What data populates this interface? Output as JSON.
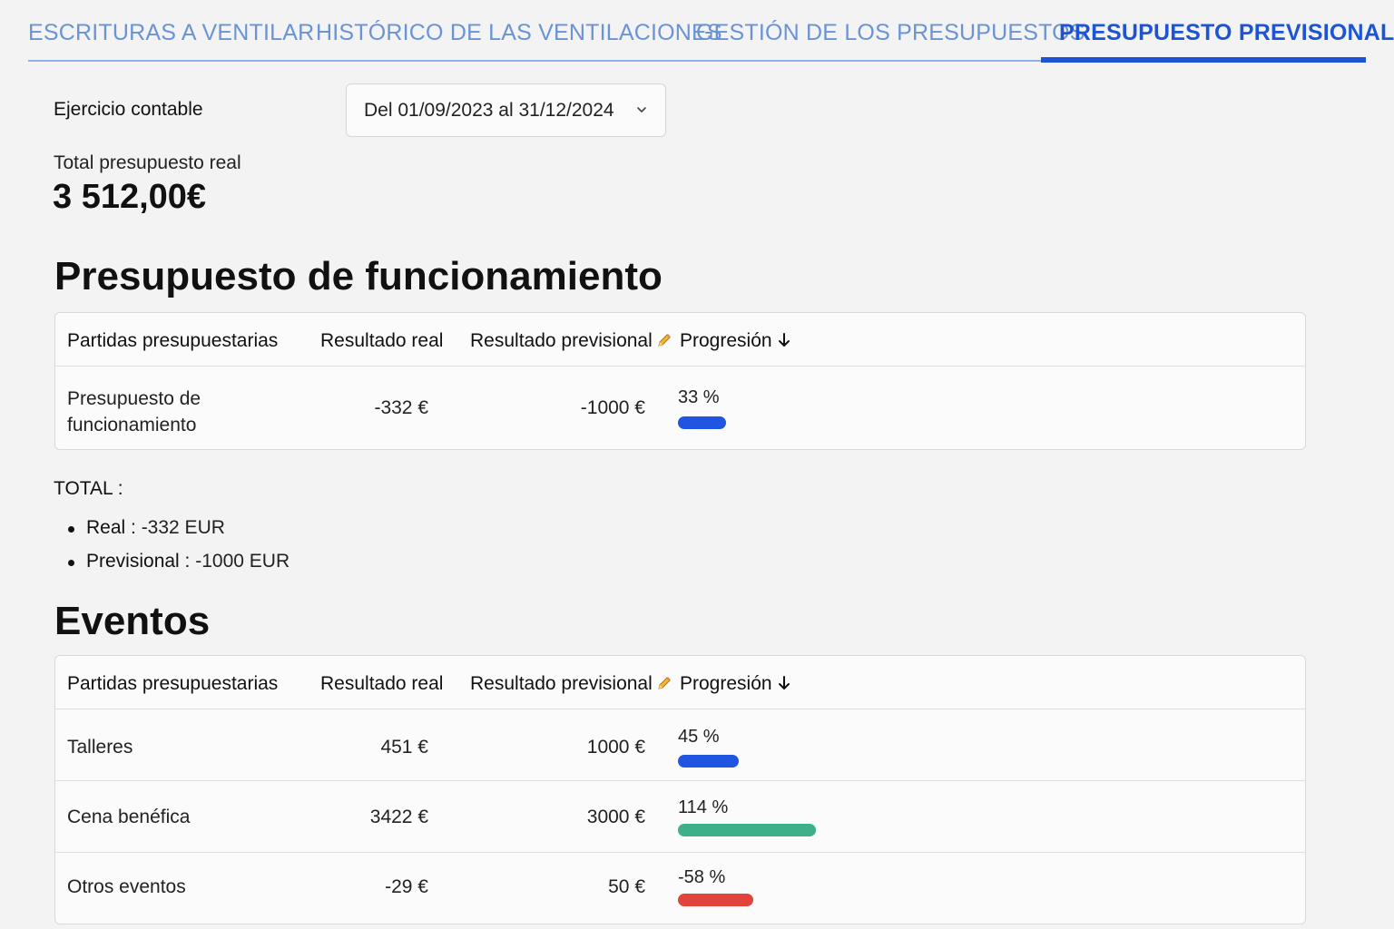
{
  "tabs": [
    {
      "label": "ESCRITURAS A VENTILAR"
    },
    {
      "label": "HISTÓRICO DE LAS VENTILACIONES"
    },
    {
      "label": "GESTIÓN DE LOS PRESUPUESTOS"
    },
    {
      "label": "PRESUPUESTO PREVISIONAL"
    }
  ],
  "active_tab": "PRESUPUESTO PREVISIONAL",
  "exercise": {
    "label": "Ejercicio contable",
    "selected": "Del 01/09/2023 al 31/12/2024"
  },
  "total": {
    "label": "Total presupuesto real",
    "value": "3 512,00€"
  },
  "columns": {
    "items": "Partidas presupuestarias",
    "real": "Resultado real",
    "forecast": "Resultado previsional",
    "progress": "Progresión"
  },
  "functioning": {
    "title": "Presupuesto de funcionamiento",
    "rows": [
      {
        "name_line1": "Presupuesto de",
        "name_line2": "funcionamiento",
        "real": "-332 €",
        "forecast": "-1000 €",
        "progress_label": "33 %",
        "progress": 33,
        "color": "#1f55e0"
      }
    ],
    "totals_title": "TOTAL :",
    "totals": [
      {
        "key": "Real :",
        "value": " -332 EUR"
      },
      {
        "key": "Previsional :",
        "value": " -1000 EUR"
      }
    ]
  },
  "events": {
    "title": "Eventos",
    "rows": [
      {
        "name": "Talleres",
        "real": "451 €",
        "forecast": "1000 €",
        "progress_label": "45 %",
        "progress": 45,
        "color": "#1f55e0"
      },
      {
        "name": "Cena benéfica",
        "real": "3422 €",
        "forecast": "3000 €",
        "progress_label": "114 %",
        "progress": 114,
        "color": "#3db08a"
      },
      {
        "name": "Otros eventos",
        "real": "-29 €",
        "forecast": "50 €",
        "progress_label": "-58 %",
        "progress": -58,
        "color": "#e0443a"
      }
    ]
  },
  "icons": {
    "pencil": "pencil-icon",
    "sort": "arrow-down-icon",
    "select": "chevron-down-icon"
  }
}
